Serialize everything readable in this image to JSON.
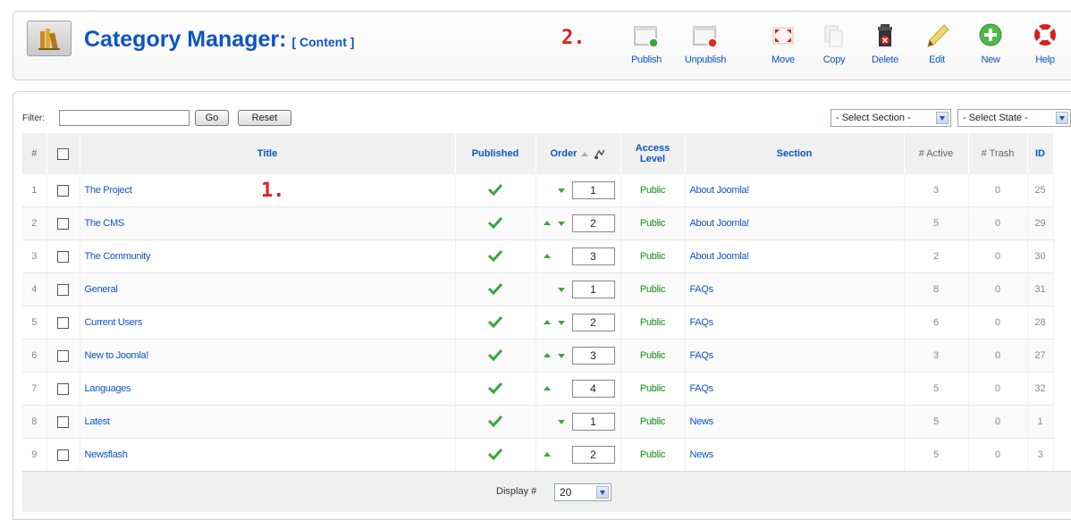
{
  "header": {
    "title": "Category Manager:",
    "subtitle": "[ Content ]",
    "annotation_toolbar": "2.",
    "annotation_table": "1."
  },
  "toolbar": [
    {
      "label": "Publish",
      "icon": "publish-icon"
    },
    {
      "label": "Unpublish",
      "icon": "unpublish-icon"
    },
    {
      "label": "Move",
      "icon": "move-icon"
    },
    {
      "label": "Copy",
      "icon": "copy-icon"
    },
    {
      "label": "Delete",
      "icon": "delete-icon"
    },
    {
      "label": "Edit",
      "icon": "edit-icon"
    },
    {
      "label": "New",
      "icon": "new-icon"
    },
    {
      "label": "Help",
      "icon": "help-icon"
    }
  ],
  "filter": {
    "label": "Filter:",
    "value": "",
    "go_label": "Go",
    "reset_label": "Reset",
    "section_select": "- Select Section -",
    "state_select": "- Select State -"
  },
  "table": {
    "columns": {
      "num": "#",
      "title": "Title",
      "published": "Published",
      "order": "Order",
      "access_line1": "Access",
      "access_line2": "Level",
      "section": "Section",
      "active": "# Active",
      "trash": "# Trash",
      "id": "ID"
    },
    "rows": [
      {
        "num": "1",
        "title": "The Project",
        "order": "1",
        "up": false,
        "down": true,
        "access": "Public",
        "section": "About Joomla!",
        "active": "3",
        "trash": "0",
        "id": "25"
      },
      {
        "num": "2",
        "title": "The CMS",
        "order": "2",
        "up": true,
        "down": true,
        "access": "Public",
        "section": "About Joomla!",
        "active": "5",
        "trash": "0",
        "id": "29"
      },
      {
        "num": "3",
        "title": "The Community",
        "order": "3",
        "up": true,
        "down": false,
        "access": "Public",
        "section": "About Joomla!",
        "active": "2",
        "trash": "0",
        "id": "30"
      },
      {
        "num": "4",
        "title": "General",
        "order": "1",
        "up": false,
        "down": true,
        "access": "Public",
        "section": "FAQs",
        "active": "8",
        "trash": "0",
        "id": "31"
      },
      {
        "num": "5",
        "title": "Current Users",
        "order": "2",
        "up": true,
        "down": true,
        "access": "Public",
        "section": "FAQs",
        "active": "6",
        "trash": "0",
        "id": "28"
      },
      {
        "num": "6",
        "title": "New to Joomla!",
        "order": "3",
        "up": true,
        "down": true,
        "access": "Public",
        "section": "FAQs",
        "active": "3",
        "trash": "0",
        "id": "27"
      },
      {
        "num": "7",
        "title": "Languages",
        "order": "4",
        "up": true,
        "down": false,
        "access": "Public",
        "section": "FAQs",
        "active": "5",
        "trash": "0",
        "id": "32"
      },
      {
        "num": "8",
        "title": "Latest",
        "order": "1",
        "up": false,
        "down": true,
        "access": "Public",
        "section": "News",
        "active": "5",
        "trash": "0",
        "id": "1"
      },
      {
        "num": "9",
        "title": "Newsflash",
        "order": "2",
        "up": true,
        "down": false,
        "access": "Public",
        "section": "News",
        "active": "5",
        "trash": "0",
        "id": "3"
      }
    ]
  },
  "footer": {
    "display_label": "Display #",
    "display_value": "20"
  },
  "colors": {
    "link": "#0B55C4",
    "published_check": "#3aa63a",
    "access_public": "#109010",
    "annotation": "#e02020"
  }
}
